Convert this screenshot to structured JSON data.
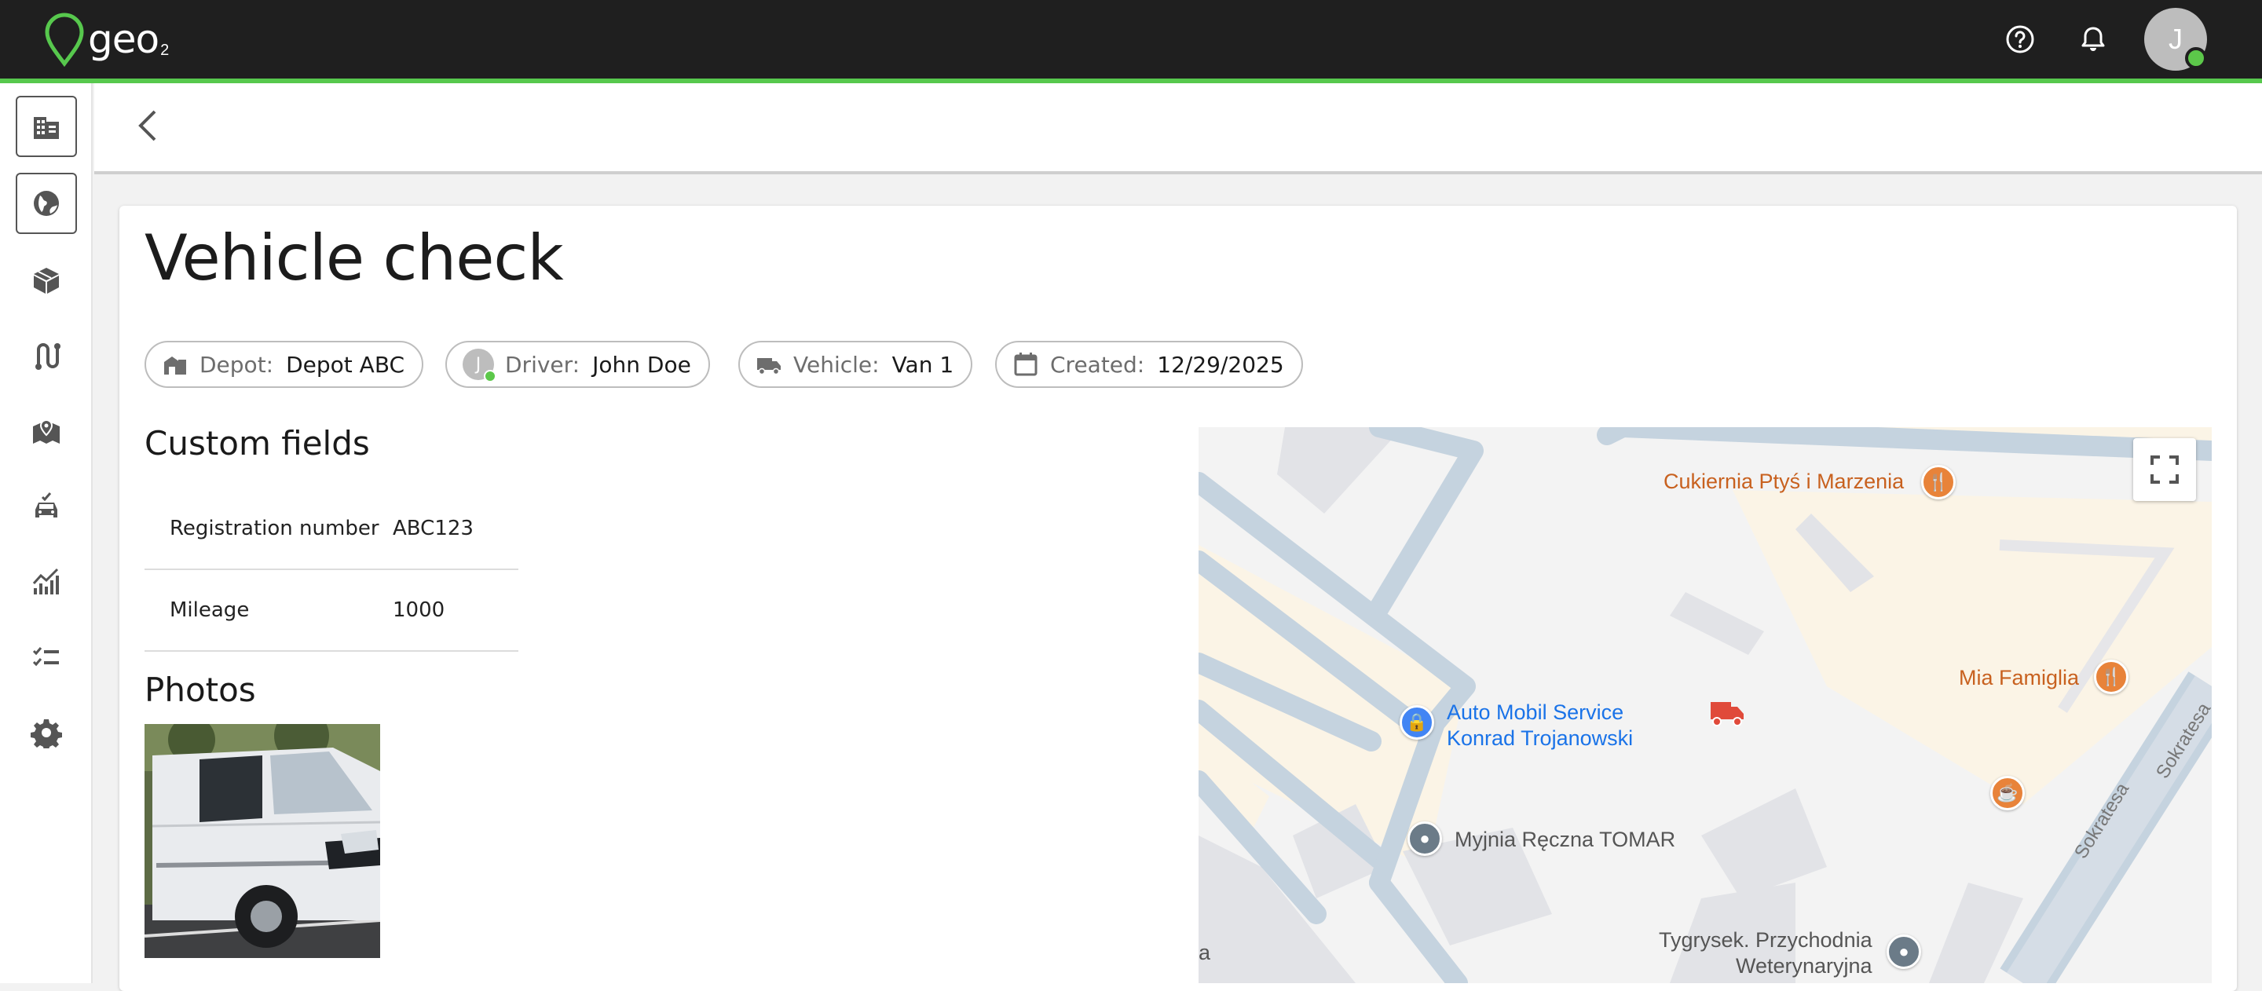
{
  "app": {
    "brand": "geo",
    "brand_sub": "2"
  },
  "topbar": {
    "icons": [
      "help-circle-icon",
      "bell-icon"
    ],
    "user_initial": "J",
    "accent_color": "#57c84d"
  },
  "sidebar": {
    "items": [
      {
        "name": "organization",
        "icon": "building-icon"
      },
      {
        "name": "map",
        "icon": "globe-icon"
      },
      {
        "name": "packages",
        "icon": "boxes-icon"
      },
      {
        "name": "routes",
        "icon": "route-icon"
      },
      {
        "name": "zones",
        "icon": "map-pin-icon"
      },
      {
        "name": "vehicles",
        "icon": "vehicle-check-icon"
      },
      {
        "name": "analytics",
        "icon": "chart-icon"
      },
      {
        "name": "tasks",
        "icon": "checklist-icon"
      },
      {
        "name": "settings",
        "icon": "gear-icon"
      }
    ]
  },
  "page": {
    "title": "Vehicle check",
    "chips": {
      "depot": {
        "label": "Depot:",
        "value": "Depot ABC"
      },
      "driver": {
        "label": "Driver:",
        "value": "John Doe",
        "initial": "J"
      },
      "vehicle": {
        "label": "Vehicle:",
        "value": "Van 1"
      },
      "created": {
        "label": "Created:",
        "value": "12/29/2025"
      }
    },
    "custom_fields_title": "Custom fields",
    "custom_fields": [
      {
        "key": "Registration number",
        "value": "ABC123"
      },
      {
        "key": "Mileage",
        "value": "1000"
      }
    ],
    "photos_title": "Photos"
  },
  "map": {
    "labels": {
      "poi1": "Cukiernia Ptyś i Marzenia",
      "poi2": "Mia Famiglia",
      "poi3_line1": "Auto Mobil Service",
      "poi3_line2": "Konrad Trojanowski",
      "poi4": "Myjnia Ręczna TOMAR",
      "poi5_line1": "Tygrysek. Przychodnia",
      "poi5_line2": "Weterynaryjna",
      "street1": "Sokratesa",
      "street2": "Sokratesa",
      "edge": "a"
    },
    "colors": {
      "road": "#c5d3df",
      "building": "#e2e3e7",
      "area": "#fbf4e6",
      "vehicle_marker": "#e04a3a",
      "food": "#e8833a",
      "service": "#4285f4",
      "generic": "#6b7b88"
    }
  }
}
